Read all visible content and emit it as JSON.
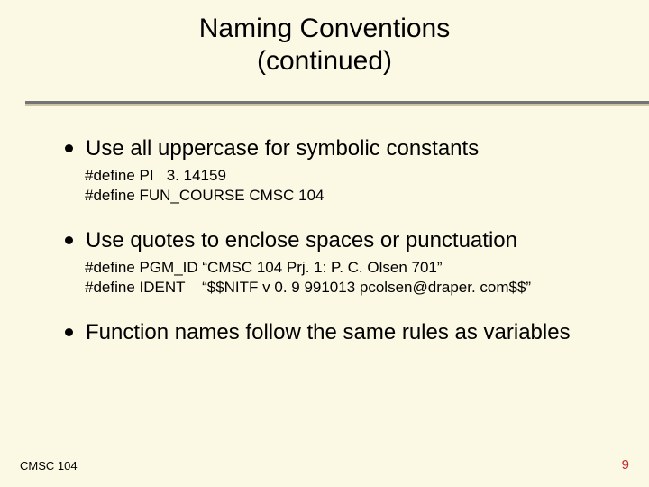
{
  "title_line1": "Naming Conventions",
  "title_line2": "(continued)",
  "bullets": [
    {
      "text": "Use all uppercase for symbolic constants",
      "code": "#define PI   3. 14159\n#define FUN_COURSE CMSC 104"
    },
    {
      "text": "Use quotes to enclose spaces or punctuation",
      "code": "#define PGM_ID “CMSC 104 Prj. 1: P. C. Olsen 701”\n#define IDENT    “$$NITF v 0. 9 991013 pcolsen@draper. com$$”"
    },
    {
      "text": "Function names follow the same rules as variables",
      "code": ""
    }
  ],
  "footer_left": "CMSC 104",
  "footer_right": "9"
}
